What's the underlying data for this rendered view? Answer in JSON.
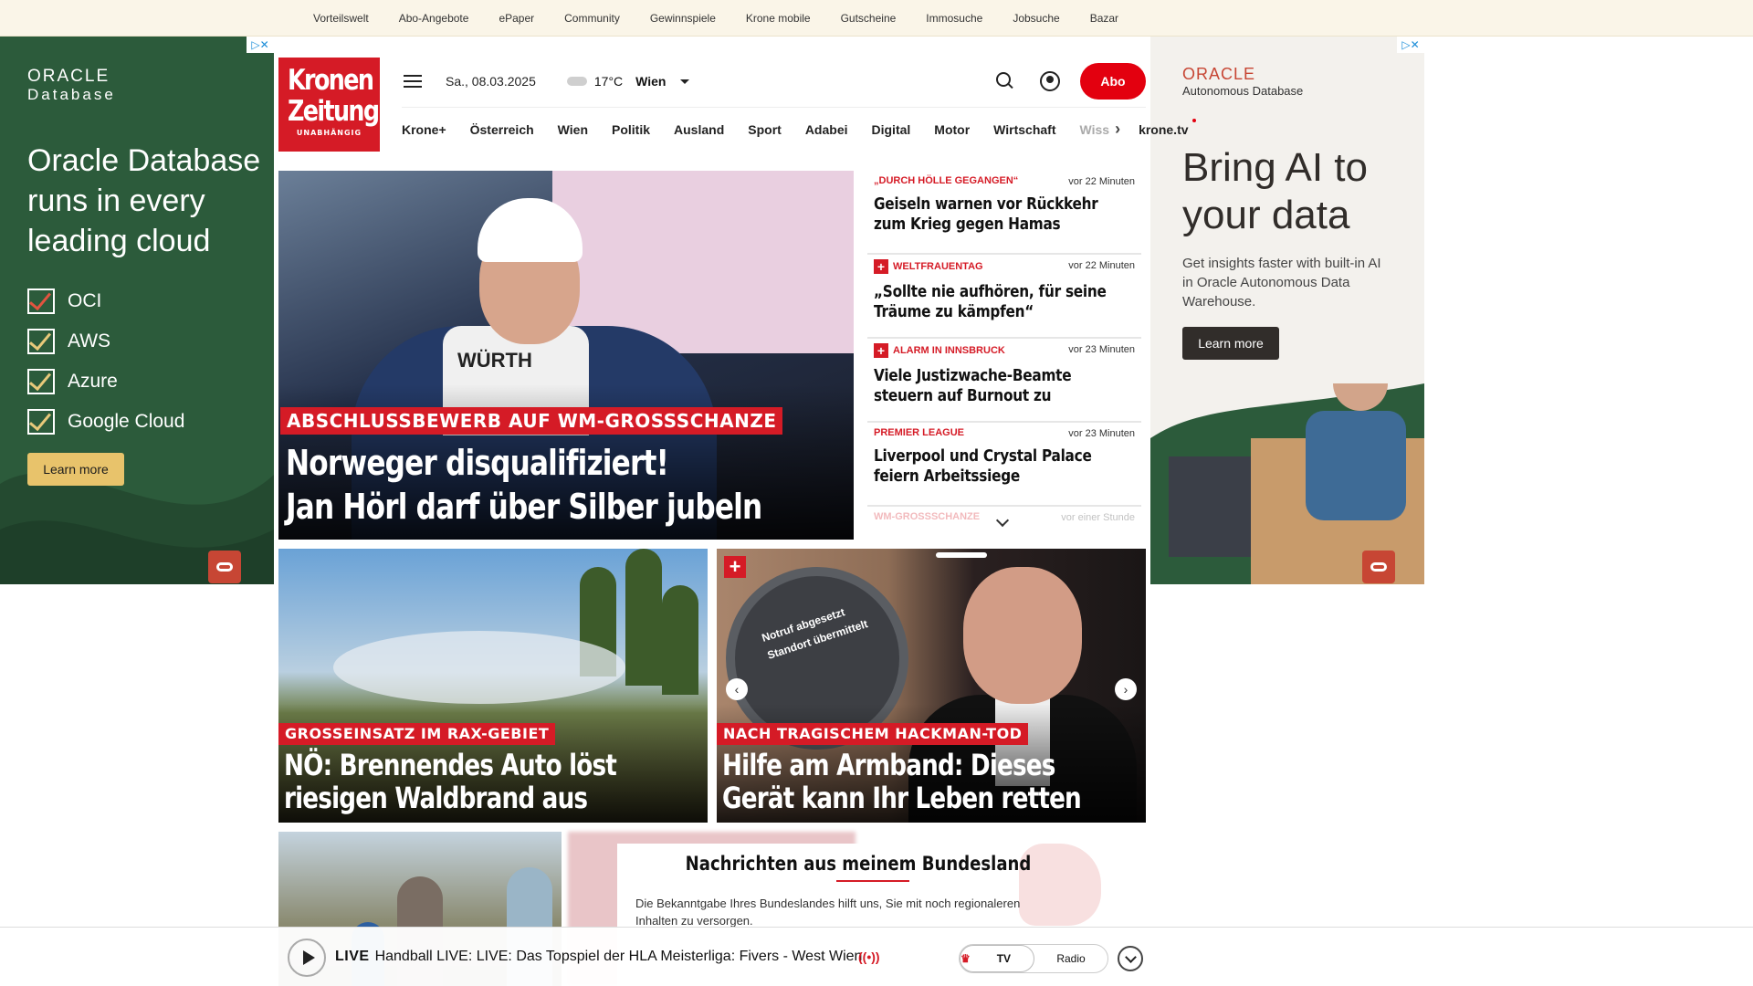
{
  "topbar": {
    "links": [
      "Vorteilswelt",
      "Abo-Angebote",
      "ePaper",
      "Community",
      "Gewinnspiele",
      "Krone mobile",
      "Gutscheine",
      "Immosuche",
      "Jobsuche",
      "Bazar"
    ]
  },
  "ad_left": {
    "brand": "ORACLE",
    "brand_sub": "Database",
    "headline": "Oracle Database runs in every leading cloud",
    "items": [
      "OCI",
      "AWS",
      "Azure",
      "Google Cloud"
    ],
    "button": "Learn more"
  },
  "ad_right": {
    "brand": "ORACLE",
    "brand_sub": "Autonomous Database",
    "headline": "Bring AI to your data",
    "sub": "Get insights faster with built-in AI in Oracle Autonomous Data Warehouse.",
    "button": "Learn more"
  },
  "logo": {
    "line1": "Kronen",
    "line2": "Zeitung",
    "tag": "UNABHÄNGIG"
  },
  "header": {
    "date": "Sa., 08.03.2025",
    "temp": "17°C",
    "city": "Wien",
    "abo": "Abo"
  },
  "nav": {
    "items": [
      "Krone+",
      "Österreich",
      "Wien",
      "Politik",
      "Ausland",
      "Sport",
      "Adabei",
      "Digital",
      "Motor",
      "Wirtschaft"
    ],
    "fade": "Wiss",
    "tv": "krone.tv"
  },
  "hero": {
    "kicker": "ABSCHLUSSBEWERB AUF WM-GROSSSCHANZE",
    "line1": "Norweger disqualifiziert!",
    "line2": "Jan Hörl darf über Silber jubeln",
    "bib": "WÜRTH"
  },
  "side_news": [
    {
      "tag": "„DURCH HÖLLE GEGANGEN“",
      "plus": false,
      "time": "vor 22 Minuten",
      "title": "Geiseln warnen vor Rückkehr zum Krieg gegen Hamas"
    },
    {
      "tag": "WELTFRAUENTAG",
      "plus": true,
      "time": "vor 22 Minuten",
      "title": "„Sollte nie aufhören, für seine Träume zu kämpfen“"
    },
    {
      "tag": "ALARM IN INNSBRUCK",
      "plus": true,
      "time": "vor 23 Minuten",
      "title": "Viele Justizwache-Beamte steuern auf Burnout zu"
    },
    {
      "tag": "PREMIER LEAGUE",
      "plus": false,
      "time": "vor 23 Minuten",
      "title": "Liverpool und Crystal Palace feiern Arbeitssiege"
    },
    {
      "tag": "WM-GROSSSCHANZE",
      "plus": false,
      "time": "vor einer Stunde",
      "title": ""
    }
  ],
  "card1": {
    "kicker": "GROSSEINSATZ IM RAX-GEBIET",
    "line1": "NÖ: Brennendes Auto löst",
    "line2": "riesigen Waldbrand aus"
  },
  "card2": {
    "kicker": "NACH TRAGISCHEM HACKMAN-TOD",
    "line1": "Hilfe am Armband: Dieses",
    "line2": "Gerät kann Ihr Leben retten",
    "watch1": "Notruf abgesetzt",
    "watch2": "Standort übermittelt"
  },
  "modal": {
    "title": "Nachrichten aus meinem Bundesland",
    "text": "Die Bekanntgabe Ihres Bundeslandes hilft uns, Sie mit noch regionaleren Inhalten zu versorgen."
  },
  "live": {
    "label": "LIVE",
    "text": "Handball LIVE: LIVE: Das Topspiel der HLA Meisterliga: Fivers - West Wien",
    "tv": "TV",
    "radio": "Radio"
  },
  "colors": {
    "brand_red": "#d51b26",
    "abo_red": "#e3000f",
    "oracle_green": "#2c5b3b",
    "oracle_gold": "#e8c36b"
  }
}
